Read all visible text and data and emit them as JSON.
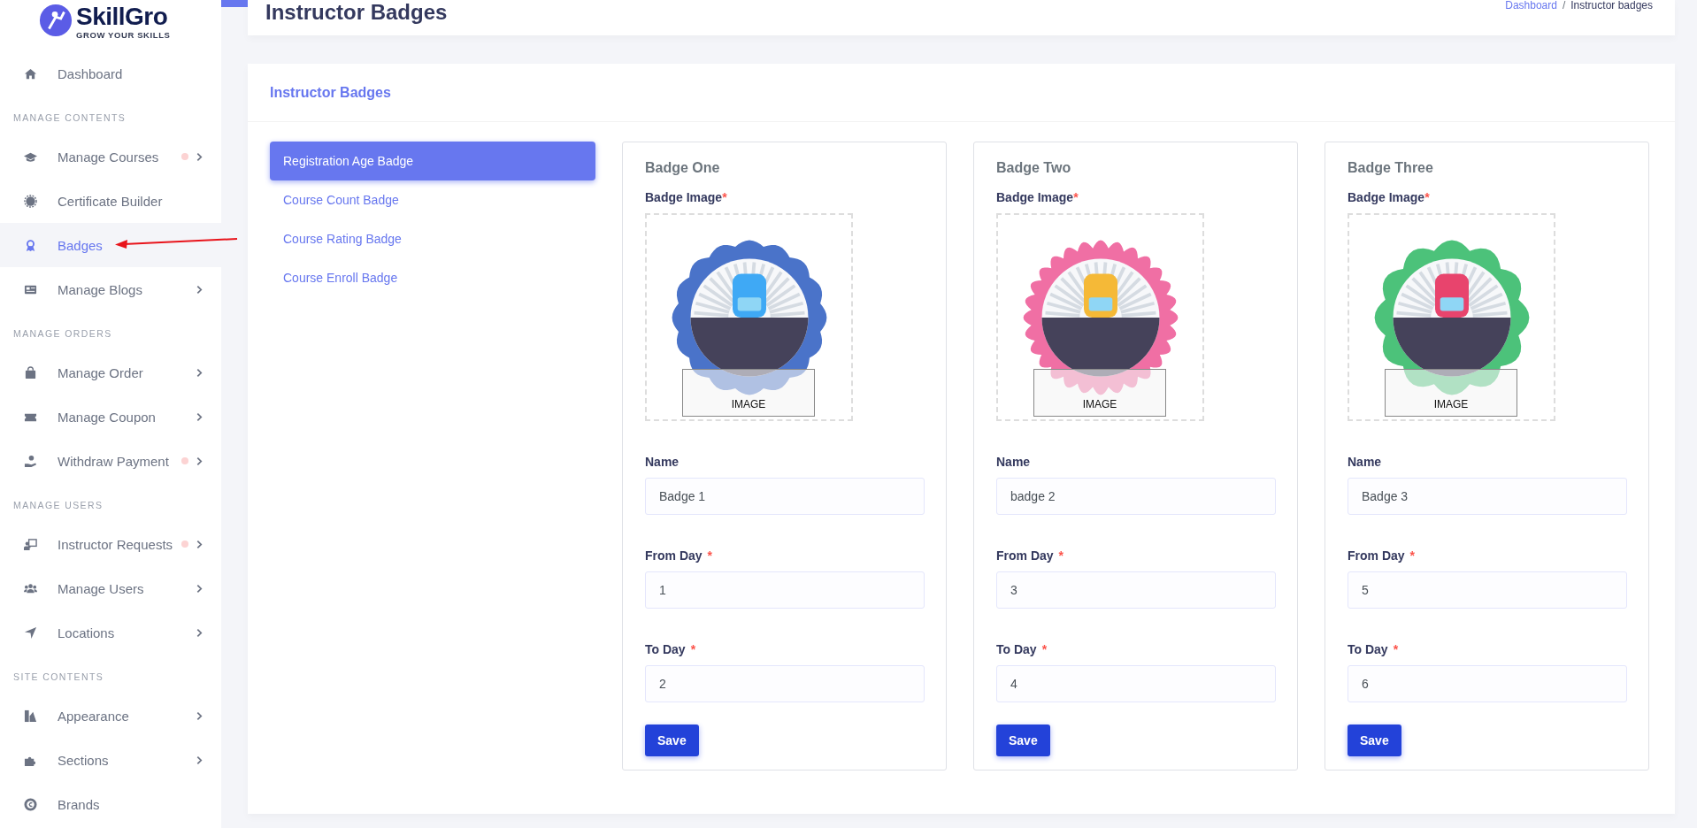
{
  "logo": {
    "name": "SkillGro",
    "tagline": "GROW YOUR SKILLS"
  },
  "sidebar": [
    {
      "kind": "item",
      "label": "Dashboard",
      "selected": false,
      "has_dot": false,
      "has_submenu": false
    },
    {
      "kind": "section",
      "label": "MANAGE CONTENTS"
    },
    {
      "kind": "item",
      "label": "Manage Courses",
      "selected": false,
      "has_dot": true,
      "has_submenu": true
    },
    {
      "kind": "item",
      "label": "Certificate Builder",
      "selected": false,
      "has_dot": false,
      "has_submenu": false
    },
    {
      "kind": "item",
      "label": "Badges",
      "selected": true,
      "has_dot": false,
      "has_submenu": false
    },
    {
      "kind": "item",
      "label": "Manage Blogs",
      "selected": false,
      "has_dot": false,
      "has_submenu": true
    },
    {
      "kind": "section",
      "label": "MANAGE ORDERS"
    },
    {
      "kind": "item",
      "label": "Manage Order",
      "selected": false,
      "has_dot": false,
      "has_submenu": true
    },
    {
      "kind": "item",
      "label": "Manage Coupon",
      "selected": false,
      "has_dot": false,
      "has_submenu": true
    },
    {
      "kind": "item",
      "label": "Withdraw Payment",
      "selected": false,
      "has_dot": true,
      "has_submenu": true
    },
    {
      "kind": "section",
      "label": "MANAGE USERS"
    },
    {
      "kind": "item",
      "label": "Instructor Requests",
      "selected": false,
      "has_dot": true,
      "has_submenu": true
    },
    {
      "kind": "item",
      "label": "Manage Users",
      "selected": false,
      "has_dot": false,
      "has_submenu": true
    },
    {
      "kind": "item",
      "label": "Locations",
      "selected": false,
      "has_dot": false,
      "has_submenu": true
    },
    {
      "kind": "section",
      "label": "SITE CONTENTS"
    },
    {
      "kind": "item",
      "label": "Appearance",
      "selected": false,
      "has_dot": false,
      "has_submenu": true
    },
    {
      "kind": "item",
      "label": "Sections",
      "selected": false,
      "has_dot": false,
      "has_submenu": true
    },
    {
      "kind": "item",
      "label": "Brands",
      "selected": false,
      "has_dot": false,
      "has_submenu": false
    }
  ],
  "page_header": {
    "title": "Instructor Badges",
    "breadcrumb": {
      "items": [
        "Dashboard",
        "Instructor badges"
      ],
      "separator": "/"
    }
  },
  "panel": {
    "title": "Instructor Badges",
    "tabs": [
      {
        "label": "Registration Age Badge",
        "selected": true
      },
      {
        "label": "Course Count Badge",
        "selected": false
      },
      {
        "label": "Course Rating Badge",
        "selected": false
      },
      {
        "label": "Course Enroll Badge",
        "selected": false
      }
    ],
    "badges": [
      {
        "title": "Badge One",
        "image_label": "Badge Image",
        "image_required": "*",
        "image_button": "IMAGE",
        "fields": [
          {
            "label": "Name",
            "value": "Badge 1"
          },
          {
            "label": "From Day",
            "required": "*",
            "value": "1"
          },
          {
            "label": "To Day",
            "required": "*",
            "value": "2"
          }
        ],
        "button": "Save"
      },
      {
        "title": "Badge Two",
        "image_label": "Badge Image",
        "image_required": "*",
        "image_button": "IMAGE",
        "fields": [
          {
            "label": "Name",
            "value": "badge 2"
          },
          {
            "label": "From Day",
            "required": "*",
            "value": "3"
          },
          {
            "label": "To Day",
            "required": "*",
            "value": "4"
          }
        ],
        "button": "Save"
      },
      {
        "title": "Badge Three",
        "image_label": "Badge Image",
        "image_required": "*",
        "image_button": "IMAGE",
        "fields": [
          {
            "label": "Name",
            "value": "Badge 3"
          },
          {
            "label": "From Day",
            "required": "*",
            "value": "5"
          },
          {
            "label": "To Day",
            "required": "*",
            "value": "6"
          }
        ],
        "button": "Save"
      }
    ]
  }
}
